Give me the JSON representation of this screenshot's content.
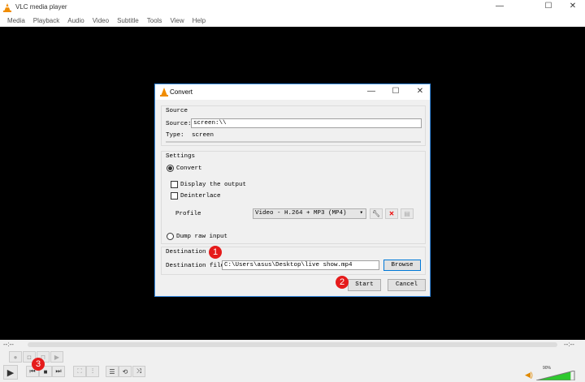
{
  "window": {
    "title": "VLC media player",
    "minimize": "—",
    "maximize": "☐",
    "close": "✕"
  },
  "menu": [
    "Media",
    "Playback",
    "Audio",
    "Video",
    "Subtitle",
    "Tools",
    "View",
    "Help"
  ],
  "dialog": {
    "title": "Convert",
    "source_group": "Source",
    "source_label": "Source:",
    "source_value": "screen:\\\\",
    "type_label": "Type:",
    "type_value": "screen",
    "settings_group": "Settings",
    "convert_label": "Convert",
    "display_output_label": "Display the output",
    "deinterlace_label": "Deinterlace",
    "profile_label": "Profile",
    "profile_value": "Video - H.264 + MP3 (MP4)",
    "dump_raw_label": "Dump raw input",
    "destination_group": "Destination",
    "destination_file_label": "Destination file:",
    "destination_value": "C:\\Users\\asus\\Desktop\\live show.mp4",
    "browse_label": "Browse",
    "start_label": "Start",
    "cancel_label": "Cancel"
  },
  "annotations": [
    "1",
    "2",
    "3"
  ],
  "player": {
    "time_left": "--:--",
    "time_right": "--:--",
    "volume": "90%",
    "volume_level": 0.9
  }
}
